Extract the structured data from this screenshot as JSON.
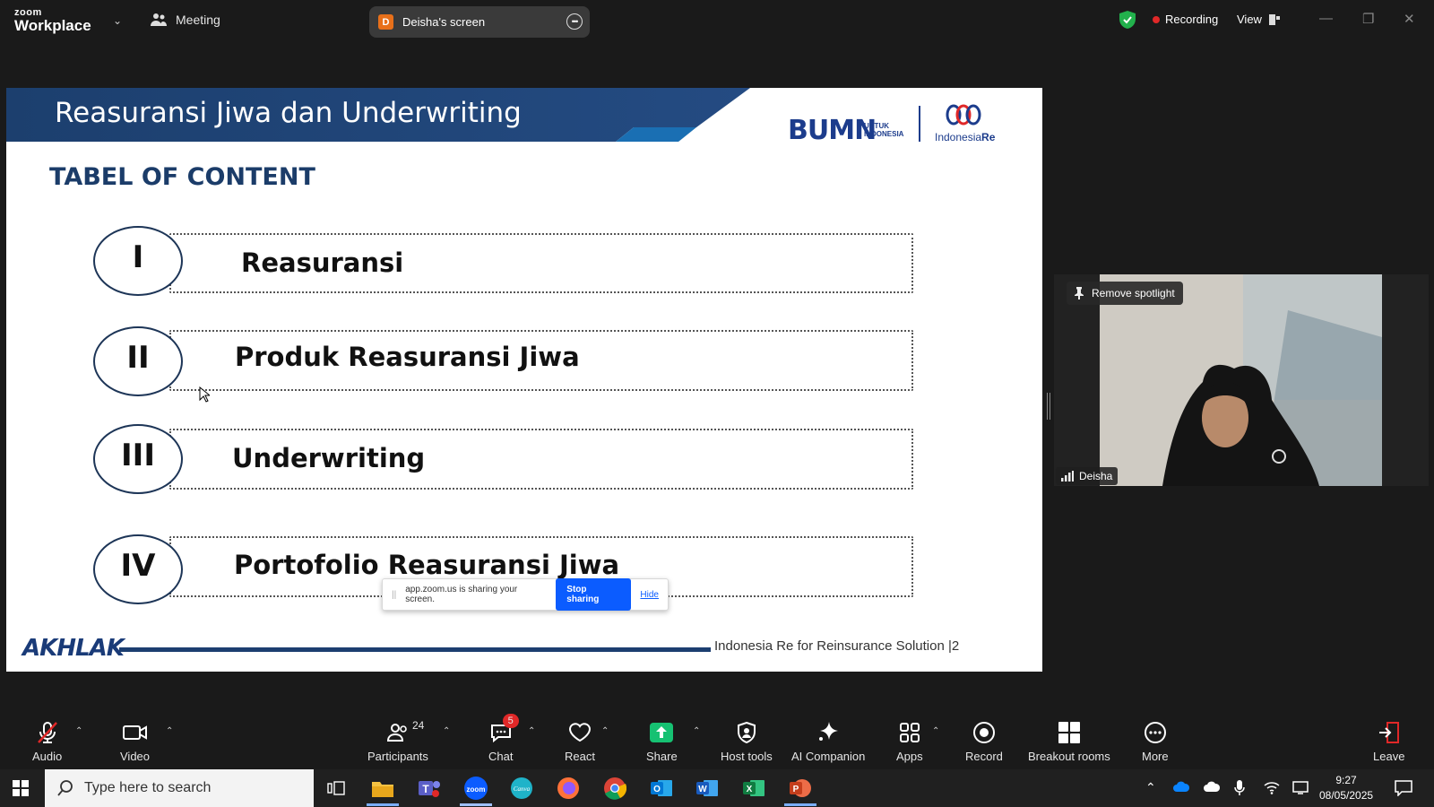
{
  "app": {
    "logo_top": "zoom",
    "logo_bottom": "Workplace",
    "meeting_label": "Meeting",
    "screen_pill": {
      "initial": "D",
      "label": "Deisha's screen"
    },
    "recording_label": "Recording",
    "view_label": "View"
  },
  "slide": {
    "title": "Reasuransi Jiwa dan Underwriting",
    "logo_bumn": "BUMN",
    "logo_bumn_sub_1": "UNTUK",
    "logo_bumn_sub_2": "INDONESIA",
    "logo_ire_name": "Indonesia",
    "logo_ire_suffix": "Re",
    "toc_heading": "TABEL OF CONTENT",
    "rows": [
      {
        "numeral": "I",
        "label": "Reasuransi"
      },
      {
        "numeral": "II",
        "label": "Produk Reasuransi Jiwa"
      },
      {
        "numeral": "III",
        "label": "Underwriting"
      },
      {
        "numeral": "IV",
        "label": "Portofolio Reasuransi Jiwa"
      }
    ],
    "footer_brand": "AKHLAK",
    "footer_text": "Indonesia Re for Reinsurance Solution",
    "page_number": "|2"
  },
  "share_bar": {
    "message": "app.zoom.us is sharing your screen.",
    "stop_label": "Stop sharing",
    "hide_label": "Hide"
  },
  "video": {
    "remove_spotlight": "Remove spotlight",
    "participant_name": "Deisha"
  },
  "toolbar": {
    "audio": "Audio",
    "video": "Video",
    "participants": "Participants",
    "participants_count": "24",
    "chat": "Chat",
    "chat_badge": "5",
    "react": "React",
    "share": "Share",
    "host_tools": "Host tools",
    "ai_companion": "AI Companion",
    "apps": "Apps",
    "record": "Record",
    "breakout_rooms": "Breakout rooms",
    "more": "More",
    "leave": "Leave"
  },
  "taskbar": {
    "search_placeholder": "Type here to search",
    "time": "9:27",
    "date": "08/05/2025"
  },
  "colors": {
    "banner_blue": "#1c3f6e",
    "accent_blue": "#0b5cff",
    "share_green": "#16c172",
    "recording_red": "#e02828",
    "leave_red": "#e02828"
  }
}
